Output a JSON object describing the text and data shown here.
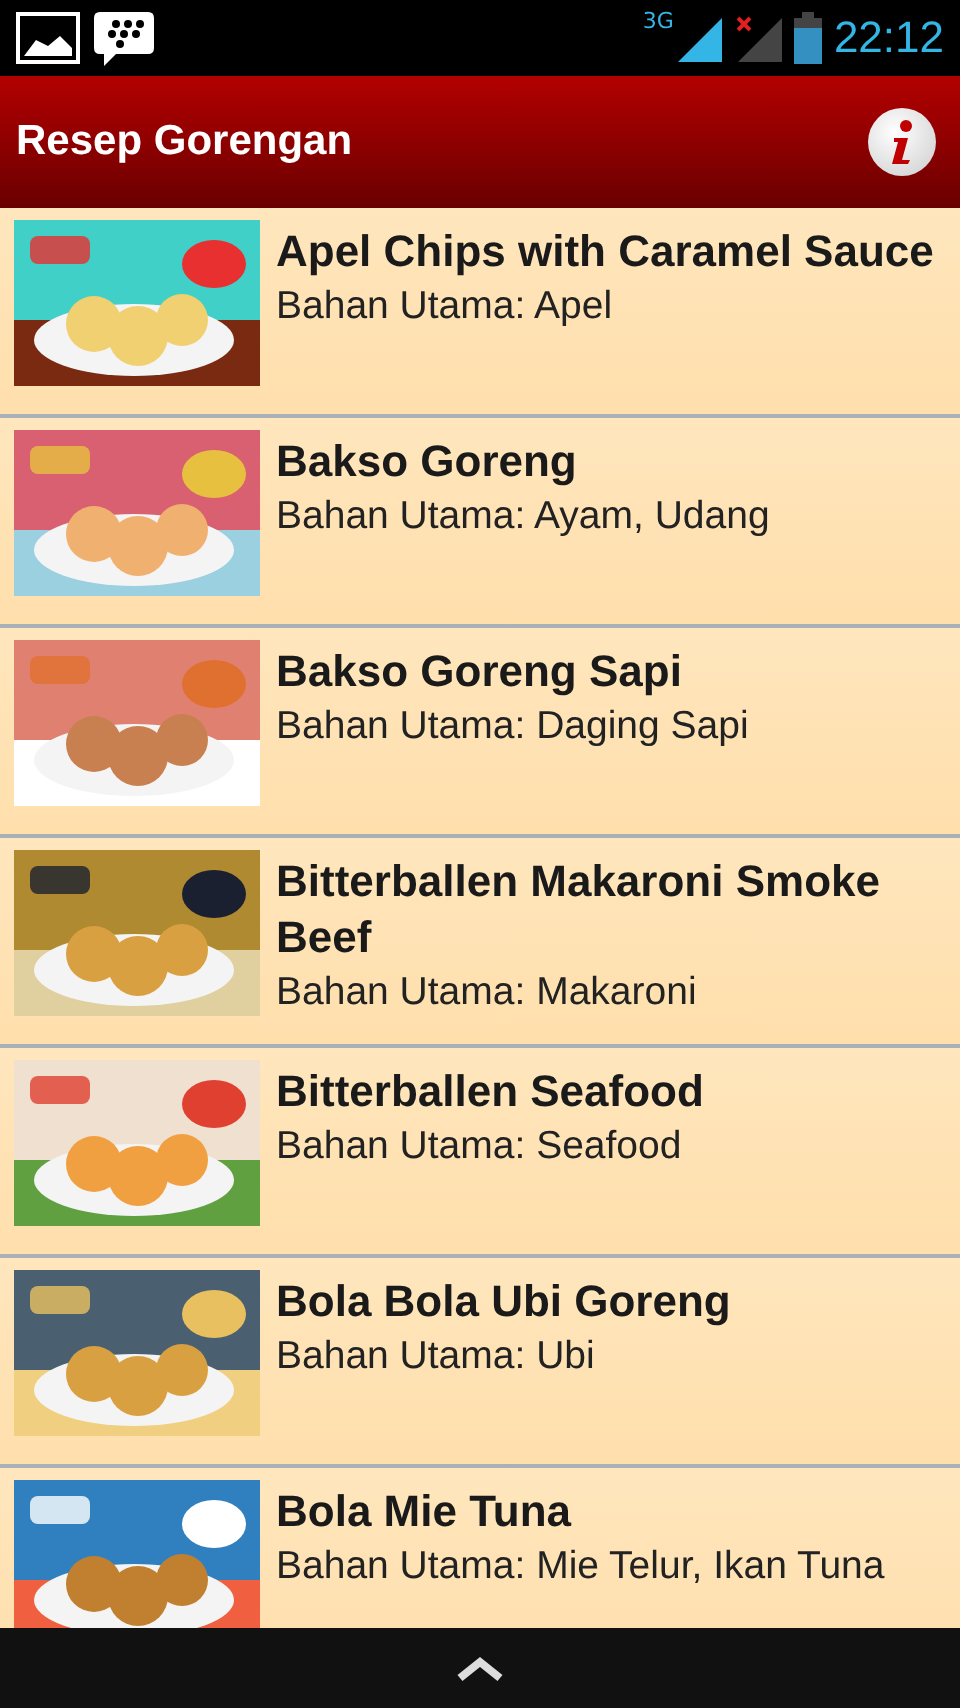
{
  "status_bar": {
    "network": "3G",
    "time": "22:12"
  },
  "app_bar": {
    "title": "Resep Gorengan"
  },
  "recipes": [
    {
      "title": "Apel Chips with Caramel Sauce",
      "subtitle": "Bahan Utama: Apel"
    },
    {
      "title": "Bakso Goreng",
      "subtitle": "Bahan Utama: Ayam, Udang"
    },
    {
      "title": "Bakso Goreng Sapi",
      "subtitle": "Bahan Utama: Daging Sapi"
    },
    {
      "title": "Bitterballen Makaroni Smoke Beef",
      "subtitle": "Bahan Utama: Makaroni"
    },
    {
      "title": "Bitterballen Seafood",
      "subtitle": "Bahan Utama: Seafood"
    },
    {
      "title": "Bola Bola Ubi Goreng",
      "subtitle": "Bahan Utama: Ubi"
    },
    {
      "title": "Bola Mie Tuna",
      "subtitle": "Bahan Utama: Mie Telur, Ikan Tuna"
    }
  ]
}
